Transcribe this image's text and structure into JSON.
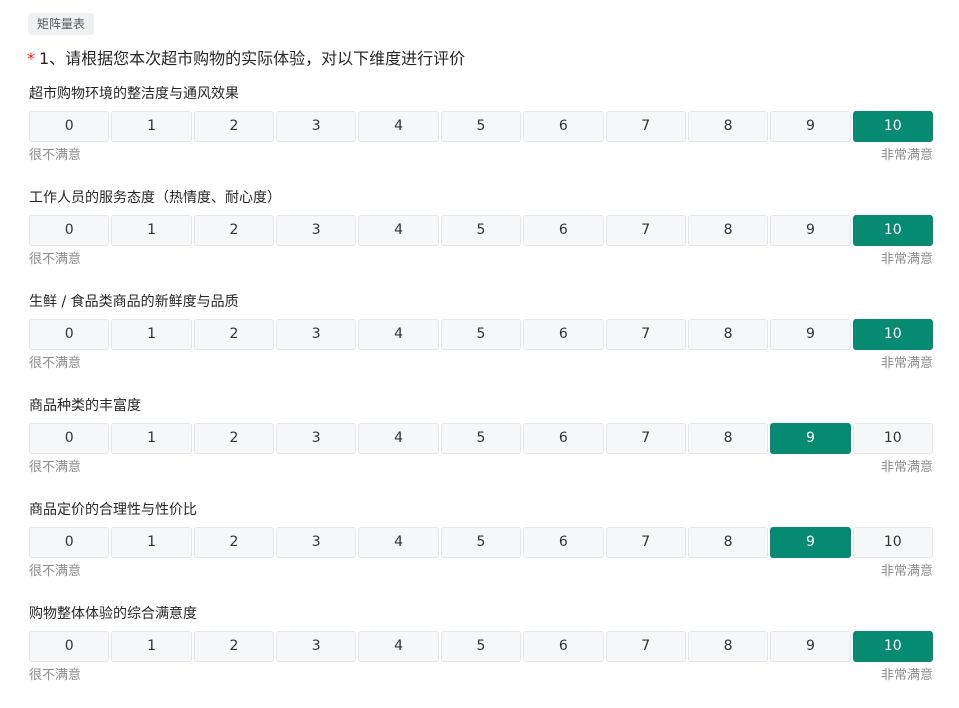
{
  "question": {
    "type_badge": "矩阵量表",
    "required_mark": "*",
    "title": "1、请根据您本次超市购物的实际体验，对以下维度进行评价",
    "scale_labels": {
      "low": "很不满意",
      "high": "非常满意"
    },
    "options": [
      "0",
      "1",
      "2",
      "3",
      "4",
      "5",
      "6",
      "7",
      "8",
      "9",
      "10"
    ],
    "accent_color": "#078a72",
    "rows": [
      {
        "label": "超市购物环境的整洁度与通风效果",
        "selected": 10
      },
      {
        "label": "工作人员的服务态度（热情度、耐心度）",
        "selected": 10
      },
      {
        "label": "生鲜 / 食品类商品的新鲜度与品质",
        "selected": 10
      },
      {
        "label": "商品种类的丰富度",
        "selected": 9
      },
      {
        "label": "商品定价的合理性与性价比",
        "selected": 9
      },
      {
        "label": "购物整体体验的综合满意度",
        "selected": 10
      }
    ]
  }
}
